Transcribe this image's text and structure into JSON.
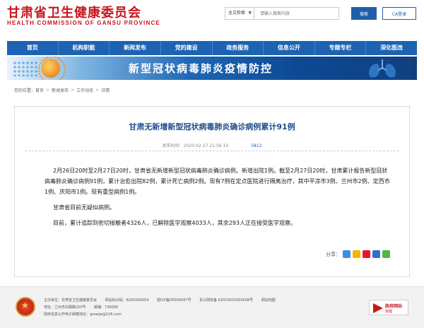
{
  "header": {
    "logo_cn": "甘肃省卫生健康委员会",
    "logo_en": "HEALTH COMMISSION OF GANSU PROVINCE",
    "search_scope": "全文检索",
    "search_placeholder": "请输入搜索内容",
    "search_button": "搜索",
    "ca_button": "CA登录"
  },
  "nav": {
    "items": [
      "首页",
      "机构职能",
      "新闻发布",
      "党的建设",
      "政务服务",
      "信息公开",
      "专题专栏",
      "深化医改"
    ]
  },
  "banner": {
    "title": "新型冠状病毒肺炎疫情防控"
  },
  "breadcrumb": {
    "label": "您的位置：",
    "items": [
      "首页",
      "新闻发布",
      "工作动态",
      "详情"
    ]
  },
  "article": {
    "title": "甘肃无新增新型冠状病毒肺炎确诊病例累计91例",
    "publish_time": "发布时间：2020-02-27 21:56:10",
    "views": "5812",
    "paragraphs": [
      "2月26日20时至2月27日20时，甘肃省无新增新型冠状病毒肺炎确诊病例。新增出院1例。截至2月27日20时，甘肃累计报告新型冠状病毒肺炎确诊病例91例，累计治愈出院82例，累计死亡病例2例。现有7例在定点医院进行隔离治疗，其中平凉市3例、兰州市2例、定西市1例、庆阳市1例。现有重型病例1例。",
      "甘肃省目前无疑似病例。",
      "目前，累计追踪到密切接触者4326人，已解除医学观察4033人，其余293人正在接受医学观察。"
    ],
    "share_label": "分享："
  },
  "footer": {
    "line1": [
      "主办单位：甘肃省卫生健康委员会",
      "网站标识码：6200000054",
      "陇ICP备05000097号",
      "甘公网安备 62010002000508号",
      "网站地图"
    ],
    "line2": [
      "地址：兰州市白银路220号",
      "邮编：730000"
    ],
    "line3": [
      "政府信息公开电子邮箱地址：gsswjw@126.com"
    ],
    "badge_title": "政府网站",
    "badge_sub": "找错"
  },
  "colors": {
    "brand_red": "#c8161d",
    "nav_blue": "#1d63b3",
    "title_blue": "#1f4e8c"
  }
}
